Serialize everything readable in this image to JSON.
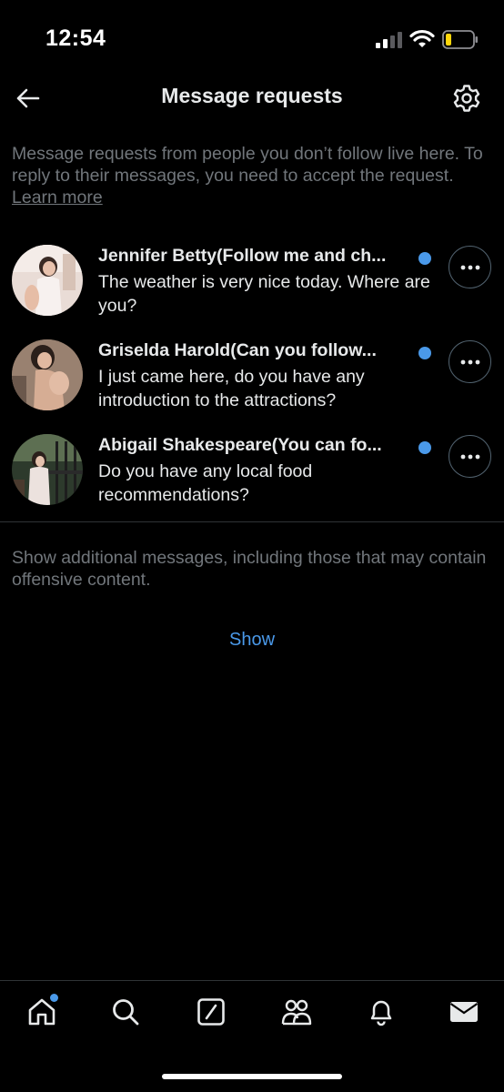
{
  "status_bar": {
    "time": "12:54"
  },
  "header": {
    "title": "Message requests"
  },
  "info": {
    "text": "Message requests from people you don’t follow live here. To reply to their messages, you need to accept the request.",
    "link": "Learn more"
  },
  "requests": [
    {
      "name": "Jennifer Betty(Follow me and ch...",
      "message": "The weather is very nice today. Where are you?",
      "unread": true
    },
    {
      "name": "Griselda Harold(Can you follow...",
      "message": "I just came here, do you have any introduction to the attractions?",
      "unread": true
    },
    {
      "name": "Abigail Shakespeare(You can fo...",
      "message": "Do you have any local food recommendations?",
      "unread": true
    }
  ],
  "additional": {
    "text": "Show additional messages, including those that may contain offensive content.",
    "show_label": "Show"
  },
  "tabs": [
    {
      "icon": "home-icon",
      "badge": true
    },
    {
      "icon": "search-icon",
      "badge": false
    },
    {
      "icon": "grok-icon",
      "badge": false
    },
    {
      "icon": "communities-icon",
      "badge": false
    },
    {
      "icon": "bell-icon",
      "badge": false
    },
    {
      "icon": "mail-icon",
      "badge": false
    }
  ],
  "colors": {
    "background": "#000000",
    "accent": "#4a99e9",
    "muted": "#71767b",
    "text": "#e7e9ea"
  }
}
